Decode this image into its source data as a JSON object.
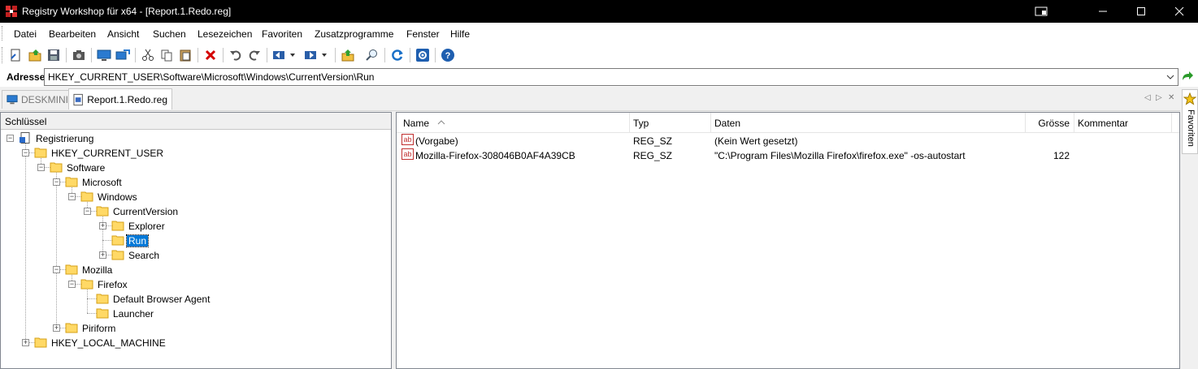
{
  "window": {
    "title": "Registry Workshop für x64 - [Report.1.Redo.reg]",
    "controls": [
      "restore-icon",
      "minimize-icon",
      "maximize-icon",
      "close-icon"
    ]
  },
  "menu": {
    "items": [
      "Datei",
      "Bearbeiten",
      "Ansicht",
      "Suchen",
      "Lesezeichen",
      "Favoriten",
      "Zusatzprogramme",
      "Fenster",
      "Hilfe"
    ]
  },
  "toolbar": {
    "icons": [
      "new-icon",
      "open-icon",
      "save-icon",
      "snapshot-icon",
      "connect-icon",
      "remote-icon",
      "cut-icon",
      "copy-icon",
      "paste-icon",
      "delete-icon",
      "undo-icon",
      "redo-icon",
      "back-icon",
      "forward-icon",
      "up-icon",
      "find-icon",
      "refresh-icon",
      "options-icon",
      "help-icon"
    ]
  },
  "address": {
    "label": "Adresse",
    "value": "HKEY_CURRENT_USER\\Software\\Microsoft\\Windows\\CurrentVersion\\Run"
  },
  "tabs": [
    {
      "label": "DESKMINI",
      "active": false
    },
    {
      "label": "Report.1.Redo.reg",
      "active": true
    }
  ],
  "favorites_tab": {
    "label": "Favoriten"
  },
  "tree": {
    "header": "Schlüssel",
    "nodes": [
      {
        "label": "Registrierung",
        "depth": 0,
        "expander": "minus",
        "icon": "registry-icon"
      },
      {
        "label": "HKEY_CURRENT_USER",
        "depth": 1,
        "expander": "minus",
        "icon": "folder-icon"
      },
      {
        "label": "Software",
        "depth": 2,
        "expander": "minus",
        "icon": "folder-icon"
      },
      {
        "label": "Microsoft",
        "depth": 3,
        "expander": "minus",
        "icon": "folder-icon"
      },
      {
        "label": "Windows",
        "depth": 4,
        "expander": "minus",
        "icon": "folder-icon"
      },
      {
        "label": "CurrentVersion",
        "depth": 5,
        "expander": "minus",
        "icon": "folder-icon"
      },
      {
        "label": "Explorer",
        "depth": 6,
        "expander": "plus",
        "icon": "folder-icon"
      },
      {
        "label": "Run",
        "depth": 6,
        "expander": "none",
        "icon": "folder-icon",
        "selected": true
      },
      {
        "label": "Search",
        "depth": 6,
        "expander": "plus",
        "icon": "folder-icon"
      },
      {
        "label": "Mozilla",
        "depth": 3,
        "expander": "minus",
        "icon": "folder-icon"
      },
      {
        "label": "Firefox",
        "depth": 4,
        "expander": "minus",
        "icon": "folder-icon"
      },
      {
        "label": "Default Browser Agent",
        "depth": 5,
        "expander": "none",
        "icon": "folder-icon"
      },
      {
        "label": "Launcher",
        "depth": 5,
        "expander": "none",
        "icon": "folder-icon"
      },
      {
        "label": "Piriform",
        "depth": 3,
        "expander": "plus",
        "icon": "folder-icon"
      },
      {
        "label": "HKEY_LOCAL_MACHINE",
        "depth": 1,
        "expander": "plus",
        "icon": "folder-icon"
      }
    ]
  },
  "list": {
    "columns": [
      "Name",
      "Typ",
      "Daten",
      "Grösse",
      "Kommentar"
    ],
    "sort_column": "Name",
    "rows": [
      {
        "name": "(Vorgabe)",
        "type": "REG_SZ",
        "data": "(Kein Wert gesetzt)",
        "size": "",
        "comment": "",
        "icon": "string-value-icon"
      },
      {
        "name": "Mozilla-Firefox-308046B0AF4A39CB",
        "type": "REG_SZ",
        "data": "\"C:\\Program Files\\Mozilla Firefox\\firefox.exe\" -os-autostart",
        "size": "122",
        "comment": "",
        "icon": "string-value-icon"
      }
    ]
  },
  "colors": {
    "titlebar": "#000000",
    "selection": "#0078d7",
    "folder": "#ffd966",
    "delete": "#d40000"
  }
}
